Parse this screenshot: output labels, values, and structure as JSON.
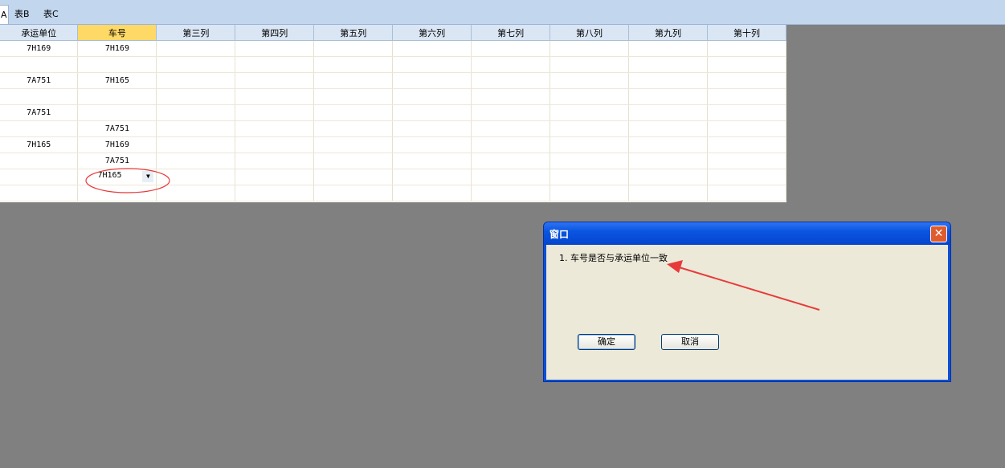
{
  "tabs": [
    {
      "label": "A"
    },
    {
      "label": "表B"
    },
    {
      "label": "表C"
    }
  ],
  "grid": {
    "columns": [
      "承运单位",
      "车号",
      "第三列",
      "第四列",
      "第五列",
      "第六列",
      "第七列",
      "第八列",
      "第九列",
      "第十列"
    ],
    "selected_column": "车号",
    "rows": [
      [
        "7H169",
        "7H169"
      ],
      [
        "",
        ""
      ],
      [
        "7A751",
        "7H165"
      ],
      [
        "",
        ""
      ],
      [
        "7A751",
        ""
      ],
      [
        "",
        "7A751"
      ],
      [
        "7H165",
        "7H169"
      ],
      [
        "",
        "7A751"
      ],
      [
        "",
        "7H165"
      ],
      [
        "",
        ""
      ]
    ],
    "editing_cell_value": "7H165"
  },
  "dialog": {
    "title": "窗口",
    "message": "1. 车号是否与承运单位一致",
    "ok_label": "确定",
    "cancel_label": "取消",
    "close_glyph": "✕"
  },
  "annotation_color": "#e83a3a"
}
